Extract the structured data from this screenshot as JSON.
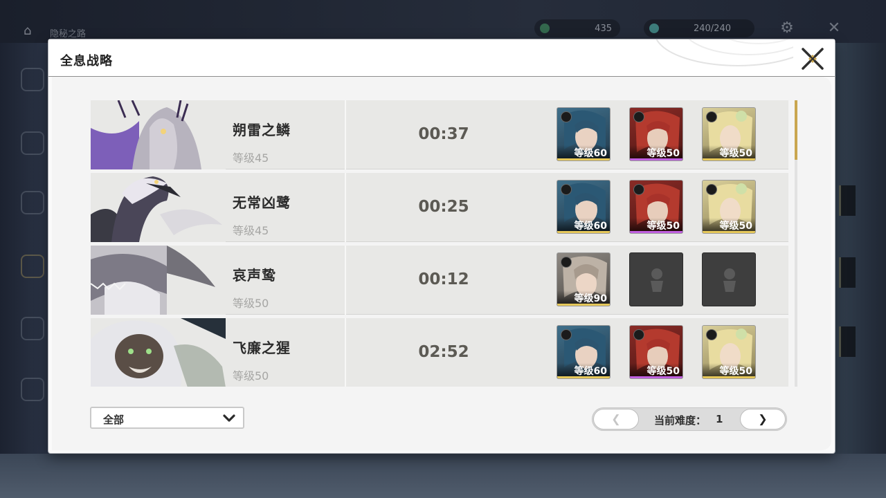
{
  "hud": {
    "title": "隐秘之路",
    "resource_a": "435",
    "resource_b": "240/240"
  },
  "dialog": {
    "title": "全息战略"
  },
  "challenges": [
    {
      "boss_name": "朔雷之鳞",
      "boss_level": "等级45",
      "clear_time": "00:37",
      "team": [
        {
          "level": "等级60",
          "element": "aero",
          "rarity_color": "#e6c85a"
        },
        {
          "level": "等级50",
          "element": "fusion",
          "rarity_color": "#c060e0"
        },
        {
          "level": "等级50",
          "element": "spectro",
          "rarity_color": "#e6c85a"
        }
      ]
    },
    {
      "boss_name": "无常凶鹭",
      "boss_level": "等级45",
      "clear_time": "00:25",
      "team": [
        {
          "level": "等级60",
          "element": "aero",
          "rarity_color": "#e6c85a"
        },
        {
          "level": "等级50",
          "element": "fusion",
          "rarity_color": "#c060e0"
        },
        {
          "level": "等级50",
          "element": "spectro",
          "rarity_color": "#e6c85a"
        }
      ]
    },
    {
      "boss_name": "哀声鸷",
      "boss_level": "等级50",
      "clear_time": "00:12",
      "team": [
        {
          "level": "等级90",
          "element": "havoc",
          "rarity_color": "#e6c85a"
        }
      ]
    },
    {
      "boss_name": "飞廉之猩",
      "boss_level": "等级50",
      "clear_time": "02:52",
      "team": [
        {
          "level": "等级60",
          "element": "aero",
          "rarity_color": "#e6c85a"
        },
        {
          "level": "等级50",
          "element": "fusion",
          "rarity_color": "#c060e0"
        },
        {
          "level": "等级50",
          "element": "spectro",
          "rarity_color": "#e6c85a"
        }
      ]
    }
  ],
  "filter": {
    "selected": "全部"
  },
  "pager": {
    "prev_label": "❮",
    "next_label": "❯",
    "difficulty_label": "当前难度：",
    "difficulty_value": "1"
  },
  "colors": {
    "accent_gold": "#c9a64f",
    "purple_rarity": "#c060e0",
    "gold_rarity": "#e6c85a"
  }
}
